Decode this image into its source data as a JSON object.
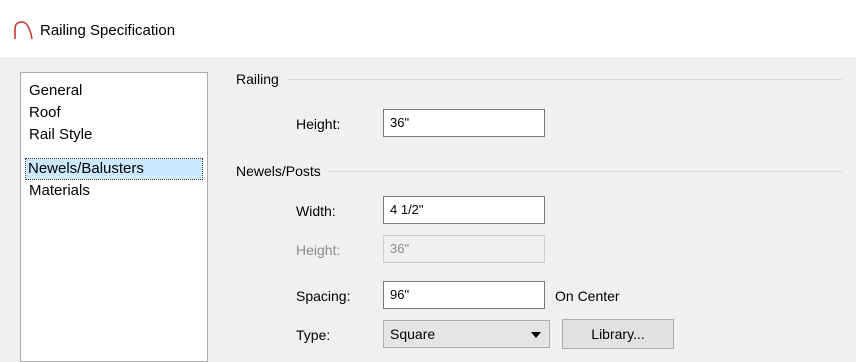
{
  "window": {
    "title": "Railing Specification",
    "icon": "railing-arc-icon"
  },
  "sidebar": {
    "items": [
      {
        "label": "General",
        "selected": false
      },
      {
        "label": "Roof",
        "selected": false
      },
      {
        "label": "Rail Style",
        "selected": false
      },
      {
        "label": "Newels/Balusters",
        "selected": true
      },
      {
        "label": "Materials",
        "selected": false
      }
    ]
  },
  "railing": {
    "title": "Railing",
    "height_label": "Height:",
    "height_value": "36\""
  },
  "newels": {
    "title": "Newels/Posts",
    "width_label": "Width:",
    "width_value": "4 1/2\"",
    "height_label": "Height:",
    "height_value": "36\"",
    "spacing_label": "Spacing:",
    "spacing_value": "96\"",
    "spacing_suffix": "On Center",
    "type_label": "Type:",
    "type_value": "Square",
    "library_label": "Library..."
  },
  "colors": {
    "selection": "#cce8ff",
    "icon_red": "#c0392b"
  }
}
